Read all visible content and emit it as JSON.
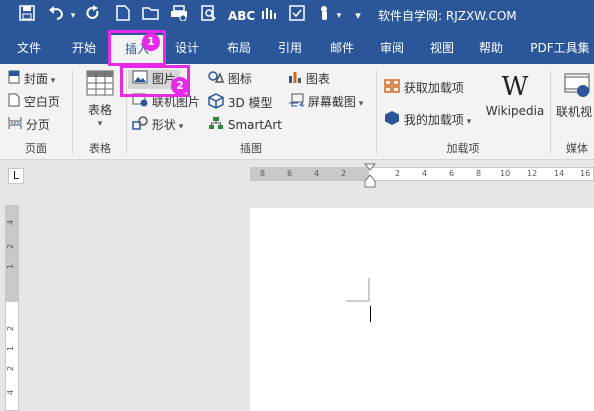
{
  "title_bar": {
    "title": "软件自学网: RJZXW.COM",
    "quick_access": [
      "save-icon",
      "undo-icon",
      "redo-icon",
      "new-document-icon",
      "open-icon",
      "quick-print-icon",
      "print-preview-icon",
      "spelling-icon",
      "read-mode-icon",
      "form-icon",
      "touch-mode-icon",
      "customize-qat-icon"
    ],
    "background": "#2b579a"
  },
  "tabs": [
    {
      "label": "文件"
    },
    {
      "label": "开始"
    },
    {
      "label": "插入"
    },
    {
      "label": "设计"
    },
    {
      "label": "布局"
    },
    {
      "label": "引用"
    },
    {
      "label": "邮件"
    },
    {
      "label": "审阅"
    },
    {
      "label": "视图"
    },
    {
      "label": "帮助"
    },
    {
      "label": "PDF工具集"
    }
  ],
  "active_tab": "插入",
  "ribbon": {
    "pages": {
      "group_label": "页面",
      "items": [
        "封面",
        "空白页",
        "分页"
      ]
    },
    "tables": {
      "group_label": "表格",
      "item": "表格"
    },
    "illustrations": {
      "group_label": "插图",
      "items": [
        "图片",
        "联机图片",
        "形状",
        "图标",
        "3D 模型",
        "SmartArt",
        "图表",
        "屏幕截图"
      ]
    },
    "addins": {
      "group_label": "加载项",
      "items": [
        "获取加载项",
        "我的加载项",
        "Wikipedia"
      ]
    },
    "media": {
      "group_label": "媒体",
      "item": "联机视"
    }
  },
  "annotations": {
    "step1": "1",
    "step2": "2",
    "highlight_color": "#e82ae8"
  },
  "ruler": {
    "corner_label": "L",
    "horizontal_ticks": [
      "8",
      "6",
      "4",
      "2",
      "2",
      "4",
      "6",
      "8",
      "10",
      "12",
      "14",
      "16"
    ],
    "vertical_ticks": [
      "4",
      "2",
      "1",
      "2",
      "1",
      "2",
      "4"
    ]
  }
}
